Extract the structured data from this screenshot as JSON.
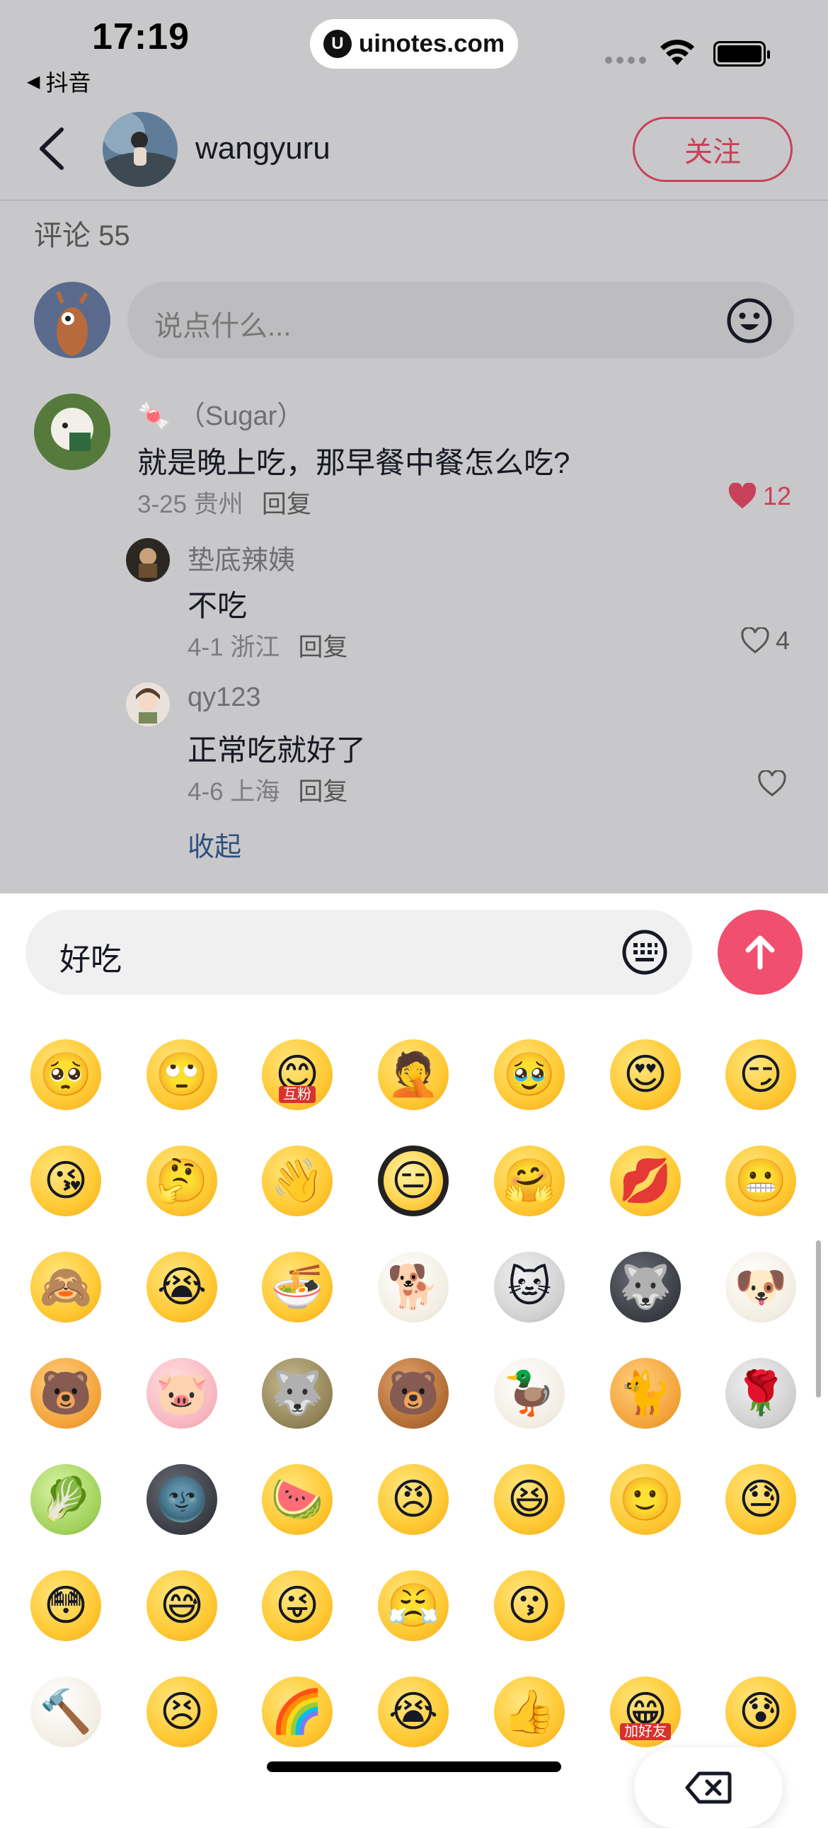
{
  "status_bar": {
    "time": "17:19",
    "back_app": "抖音",
    "url": "uinotes.com"
  },
  "header": {
    "username": "wangyuru",
    "follow_label": "关注"
  },
  "comments_section": {
    "count_label": "评论 55",
    "input_placeholder": "说点什么...",
    "comments": [
      {
        "name": "🍬 （Sugar）",
        "text": "就是晚上吃，那早餐中餐怎么吃?",
        "date": "3-25",
        "location": "贵州",
        "reply_label": "回复",
        "likes": "12",
        "liked": true
      },
      {
        "name": "垫底辣姨",
        "text": "不吃",
        "date": "4-1",
        "location": "浙江",
        "reply_label": "回复",
        "likes": "4",
        "liked": false
      },
      {
        "name": "qy123",
        "text": "正常吃就好了",
        "date": "4-6",
        "location": "上海",
        "reply_label": "回复",
        "likes": "",
        "liked": false
      }
    ],
    "collapse_label": "收起"
  },
  "composer": {
    "value": "好吃"
  },
  "emoji_panel": {
    "tags": {
      "fans": "互粉",
      "add_friend": "加好友"
    }
  },
  "colors": {
    "accent": "#f0506e",
    "follow": "#c8415a",
    "link": "#2f4f7f"
  }
}
